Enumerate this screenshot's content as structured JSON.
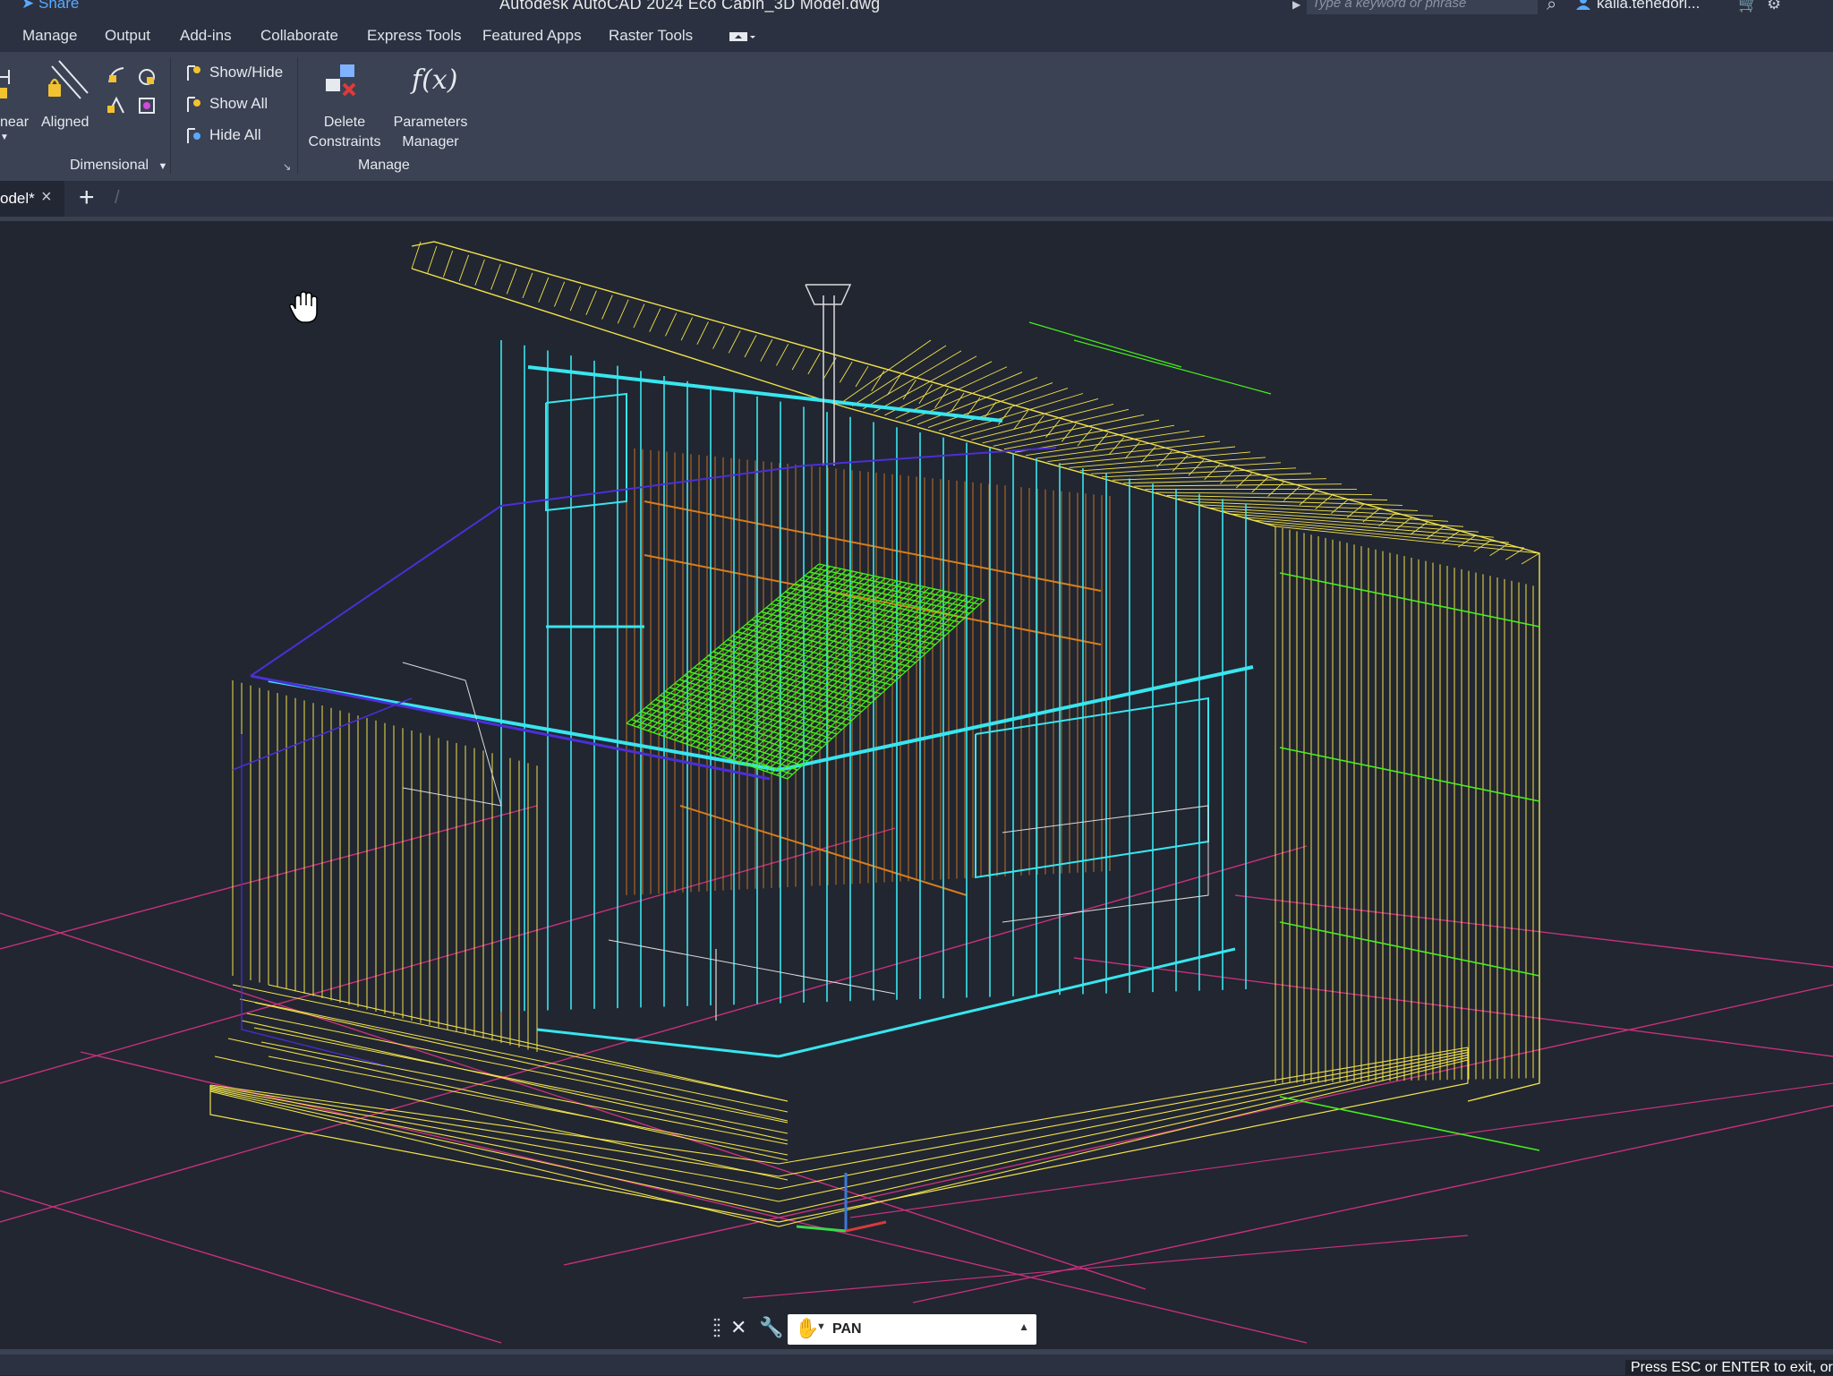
{
  "app": {
    "title": "Autodesk AutoCAD 2024   Eco Cabin_3D Model.dwg",
    "share_label": "Share",
    "search_placeholder": "Type a keyword or phrase",
    "user_name": "kalla.tenedori..."
  },
  "menu_tabs": [
    "Manage",
    "Output",
    "Add-ins",
    "Collaborate",
    "Express Tools",
    "Featured Apps",
    "Raster Tools"
  ],
  "ribbon": {
    "dimensional": {
      "linear_label": "near",
      "aligned_label": "Aligned",
      "show_hide_label": "Show/Hide",
      "show_all_label": "Show All",
      "hide_all_label": "Hide All",
      "panel_title": "Dimensional"
    },
    "manage": {
      "delete_constraints_label": [
        "Delete",
        "Constraints"
      ],
      "parameters_manager_label": [
        "Parameters",
        "Manager"
      ],
      "fx_glyph": "f(x)",
      "panel_title": "Manage"
    }
  },
  "document_tab": {
    "label": "odel*"
  },
  "command_line": {
    "text": "PAN"
  },
  "status": {
    "message": "Press ESC or ENTER to exit, or"
  },
  "colors": {
    "frame_yellow": "#f2e24a",
    "frame_cyan": "#38e6ee",
    "frame_orange": "#d97d1c",
    "frame_green": "#46f01a",
    "frame_blue": "#4b2fd6",
    "grid_magenta": "#c8307c",
    "white_lines": "#dcdcdc"
  }
}
